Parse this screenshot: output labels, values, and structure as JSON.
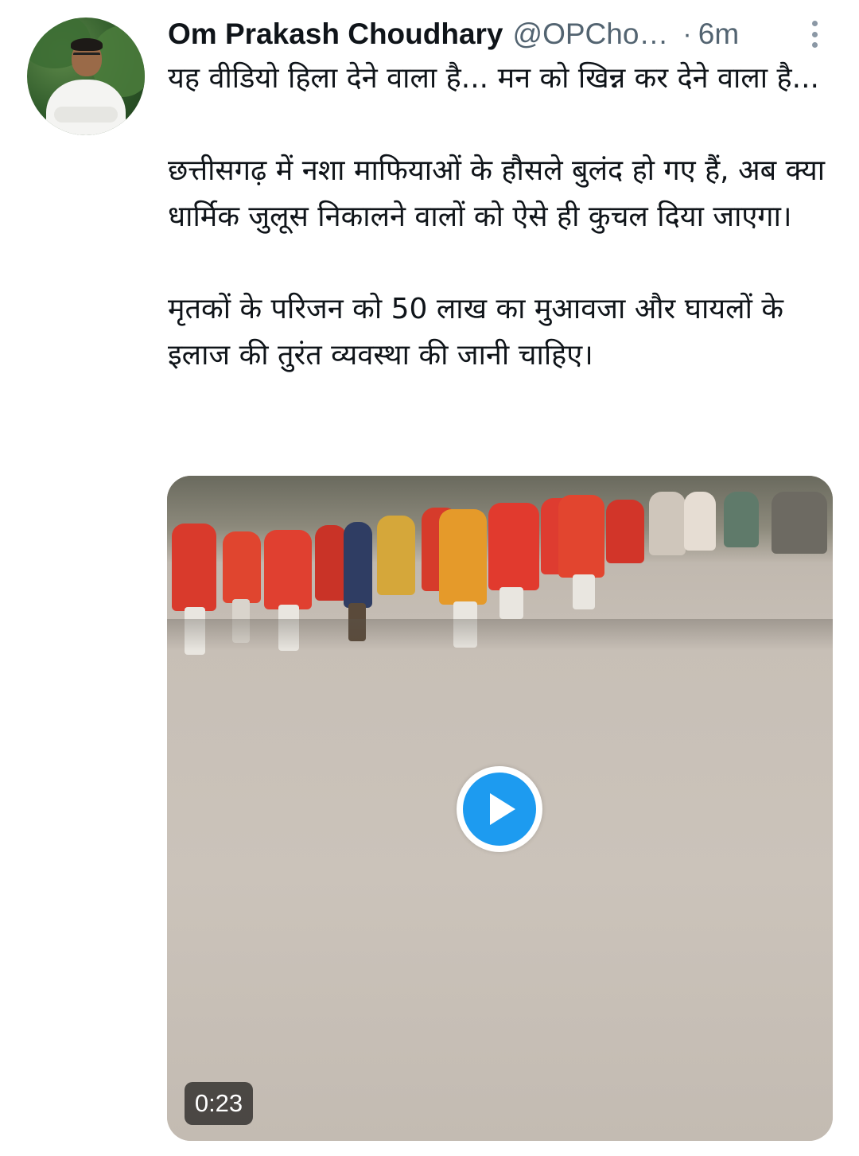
{
  "tweet": {
    "author_name": "Om Prakash Choudhary",
    "author_handle": "@OPCho…",
    "separator": "·",
    "timestamp": "6m",
    "paragraphs": [
      "यह वीडियो हिला देने वाला है... मन को खिन्न कर देने वाला है...",
      "छत्तीसगढ़ में नशा माफियाओं के हौसले बुलंद हो गए हैं, अब क्या धार्मिक जुलूस निकालने वालों को ऐसे ही कुचल दिया जाएगा।",
      "मृतकों के परिजन को 50 लाख का मुआवजा और घायलों के इलाज की तुरंत व्यवस्था की जानी चाहिए।"
    ],
    "media": {
      "type": "video",
      "duration": "0:23",
      "play_icon": "play-icon"
    },
    "menu_icon": "more-vertical-icon"
  },
  "colors": {
    "text": "#0f1419",
    "secondary_text": "#536471",
    "accent": "#1d9bf0"
  }
}
